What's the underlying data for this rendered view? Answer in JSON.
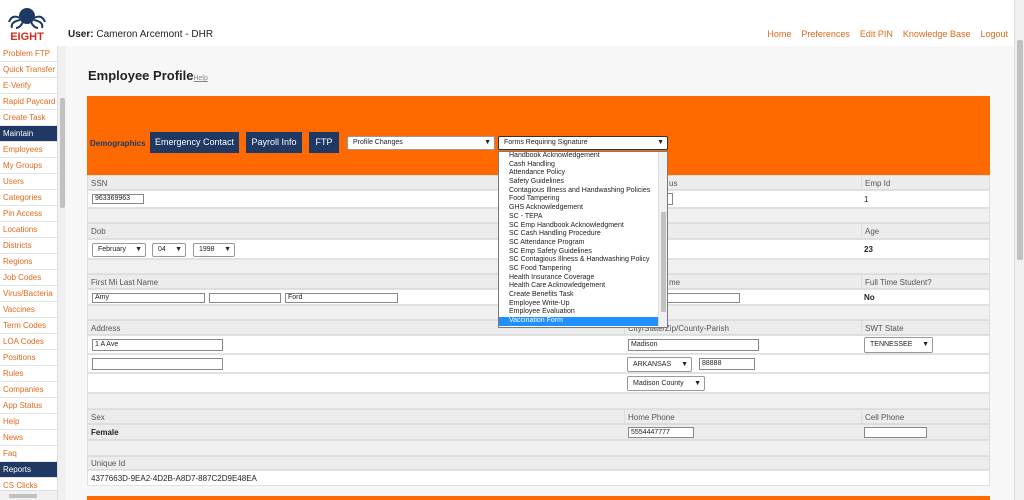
{
  "header": {
    "user_label": "User:",
    "user_name": "Cameron Arcemont - DHR",
    "logo_text": "EIGHT",
    "nav": [
      "Home",
      "Preferences",
      "Edit PIN",
      "Knowledge Base",
      "Logout"
    ]
  },
  "sidebar": {
    "items": [
      {
        "label": "Problem FTP",
        "section": false
      },
      {
        "label": "Quick Transfer",
        "section": false
      },
      {
        "label": "E-Verify",
        "section": false
      },
      {
        "label": "Rapid Paycard",
        "section": false
      },
      {
        "label": "Create Task",
        "section": false
      },
      {
        "label": "Maintain",
        "section": true
      },
      {
        "label": "Employees",
        "section": false
      },
      {
        "label": "My Groups",
        "section": false
      },
      {
        "label": "Users",
        "section": false
      },
      {
        "label": "Categories",
        "section": false
      },
      {
        "label": "Pin Access",
        "section": false
      },
      {
        "label": "Locations",
        "section": false
      },
      {
        "label": "Districts",
        "section": false
      },
      {
        "label": "Regions",
        "section": false
      },
      {
        "label": "Job Codes",
        "section": false
      },
      {
        "label": "Virus/Bacteria",
        "section": false
      },
      {
        "label": "Vaccines",
        "section": false
      },
      {
        "label": "Term Codes",
        "section": false
      },
      {
        "label": "LOA Codes",
        "section": false
      },
      {
        "label": "Positions",
        "section": false
      },
      {
        "label": "Rules",
        "section": false
      },
      {
        "label": "Companies",
        "section": false
      },
      {
        "label": "App Status",
        "section": false
      },
      {
        "label": "Help",
        "section": false
      },
      {
        "label": "News",
        "section": false
      },
      {
        "label": "Faq",
        "section": false
      },
      {
        "label": "Reports",
        "section": true
      },
      {
        "label": "CS Clicks",
        "section": false
      }
    ]
  },
  "page": {
    "title": "Employee Profile",
    "help": "Help"
  },
  "tabs": {
    "demographics": "Demographics",
    "emergency": "Emergency Contact",
    "payroll": "Payroll Info",
    "ftp": "FTP",
    "profile_changes": "Profile Changes",
    "forms_select": "Forms Requiring Signature"
  },
  "forms_list": [
    "Handbook Acknowledgement",
    "Cash Handling",
    "Attendance Policy",
    "Safety Guidelines",
    "Contagious Illness and Handwashing Policies",
    "Food Tampering",
    "GHS Acknowledgement",
    "SC - TEPA",
    "SC Emp Handbook Acknowledgment",
    "SC Cash Handling Procedure",
    "SC Attendance Program",
    "SC Emp Safety Guidelines",
    "SC Contagious Illness & Handwashing Policy",
    "SC Food Tampering",
    "Health Insurance Coverage",
    "Health Care Acknowledgement",
    "Create Benefits Task",
    "Employee Write-Up",
    "Employee Evaluation",
    "Vaccination Form"
  ],
  "fields": {
    "ssn_label": "SSN",
    "ssn": "963369963",
    "status_label_partial": "us",
    "empid_label": "Emp Id",
    "empid": "1",
    "dob_label": "Dob",
    "dob_month": "February",
    "dob_day": "04",
    "dob_year": "1998",
    "age_label": "Age",
    "age": "23",
    "name_label": "First Mi Last Name",
    "first": "Amy",
    "mi": "",
    "last": "Ford",
    "nickname_label_partial": "me",
    "fulltime_label": "Full Time Student?",
    "fulltime": "No",
    "address_label": "Address",
    "address1": "1 A Ave",
    "address2": "",
    "city_label": "City/State/Zip/County-Parish",
    "city": "Madison",
    "state": "ARKANSAS",
    "zip": "88888",
    "county": "Madison County",
    "swt_label": "SWT State",
    "swt": "TENNESSEE",
    "sex_label": "Sex",
    "sex": "Female",
    "homephone_label": "Home Phone",
    "homephone": "5554447777",
    "cellphone_label": "Cell Phone",
    "cellphone": "",
    "uid_label": "Unique Id",
    "uid": "4377663D-9EA2-4D2B-A8D7-887C2D9E48EA"
  },
  "colors": {
    "accent": "#ff6a00",
    "navy": "#1f3864",
    "link": "#e06a1c",
    "highlight": "#1e90ff"
  }
}
